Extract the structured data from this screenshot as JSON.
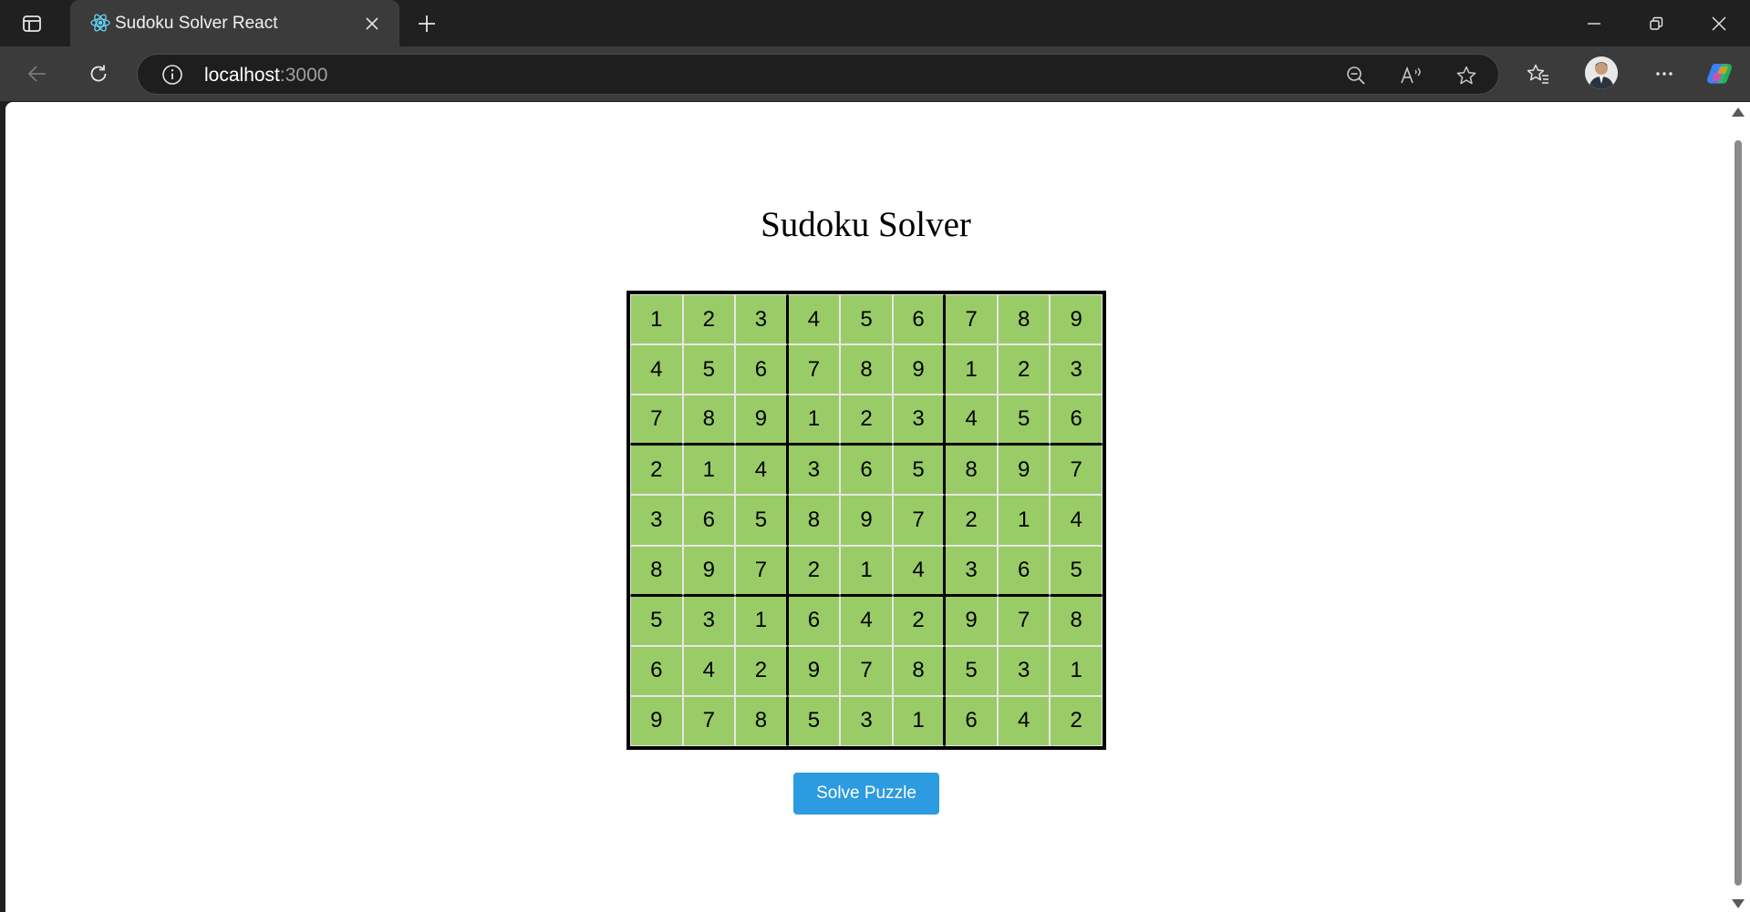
{
  "browser": {
    "tab": {
      "title": "Sudoku Solver React",
      "favicon": "react-icon"
    },
    "address": {
      "host": "localhost",
      "port": ":3000"
    },
    "colors": {
      "chrome_dark": "#202020",
      "toolbar": "#3b3b3b"
    }
  },
  "page": {
    "title": "Sudoku Solver",
    "solve_button_label": "Solve Puzzle",
    "cell_color": "#99cc66",
    "button_color": "#2d9be0"
  },
  "board": {
    "rows": [
      [
        "1",
        "2",
        "3",
        "4",
        "5",
        "6",
        "7",
        "8",
        "9"
      ],
      [
        "4",
        "5",
        "6",
        "7",
        "8",
        "9",
        "1",
        "2",
        "3"
      ],
      [
        "7",
        "8",
        "9",
        "1",
        "2",
        "3",
        "4",
        "5",
        "6"
      ],
      [
        "2",
        "1",
        "4",
        "3",
        "6",
        "5",
        "8",
        "9",
        "7"
      ],
      [
        "3",
        "6",
        "5",
        "8",
        "9",
        "7",
        "2",
        "1",
        "4"
      ],
      [
        "8",
        "9",
        "7",
        "2",
        "1",
        "4",
        "3",
        "6",
        "5"
      ],
      [
        "5",
        "3",
        "1",
        "6",
        "4",
        "2",
        "9",
        "7",
        "8"
      ],
      [
        "6",
        "4",
        "2",
        "9",
        "7",
        "8",
        "5",
        "3",
        "1"
      ],
      [
        "9",
        "7",
        "8",
        "5",
        "3",
        "1",
        "6",
        "4",
        "2"
      ]
    ]
  }
}
